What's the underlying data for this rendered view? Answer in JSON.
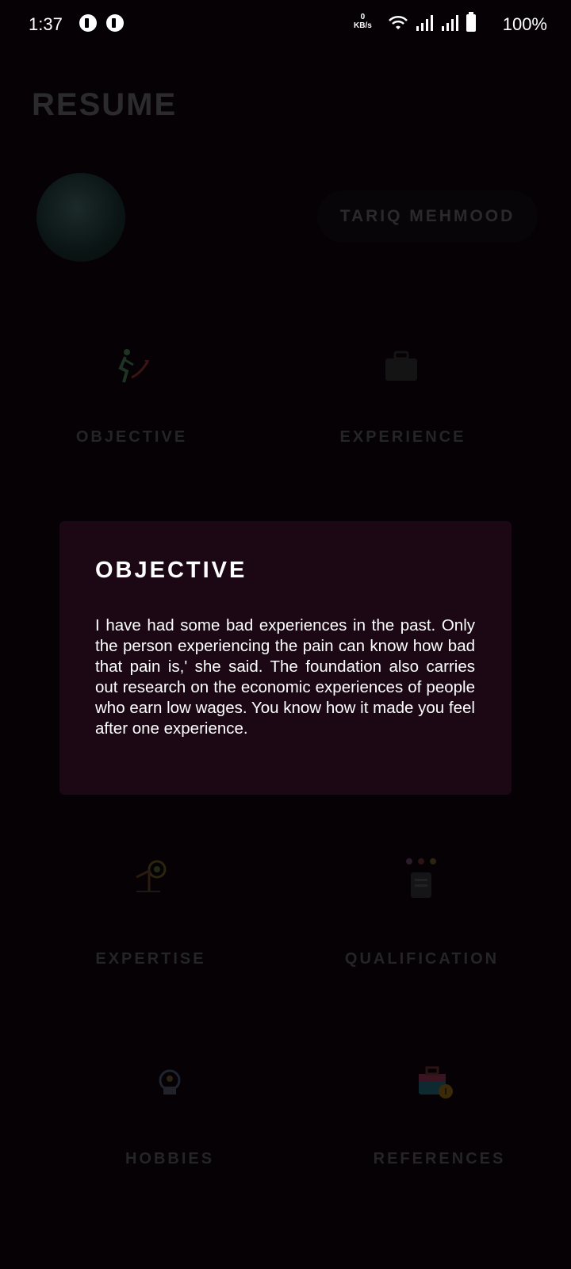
{
  "status_bar": {
    "time": "1:37",
    "net_speed_value": "0",
    "net_speed_unit": "KB/s",
    "battery": "100%"
  },
  "app": {
    "title": "RESUME",
    "name": "TARIQ MEHMOOD",
    "tiles": [
      {
        "label": "OBJECTIVE",
        "icon": "running-person-icon"
      },
      {
        "label": "EXPERIENCE",
        "icon": "briefcase-icon"
      },
      {
        "label": "EXPERTISE",
        "icon": "target-icon"
      },
      {
        "label": "QUALIFICATION",
        "icon": "clipboard-team-icon"
      },
      {
        "label": "HOBBIES",
        "icon": "hobbies-icon"
      },
      {
        "label": "REFERENCES",
        "icon": "bag-key-icon"
      }
    ]
  },
  "dialog": {
    "title": "OBJECTIVE",
    "body": "I have had some bad experiences in the past. Only the person experiencing the pain can know how bad that pain is,' she said. The foundation also carries out research on the economic experiences of people who earn low wages. You know how it made you feel after one experience."
  }
}
